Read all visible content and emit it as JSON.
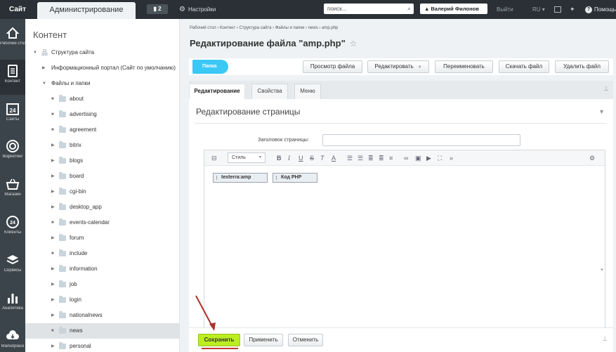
{
  "topbar": {
    "site_label": "Сайт",
    "admin_label": "Администрирование",
    "notifications_count": "2",
    "settings_label": "Настройки",
    "search_placeholder": "поиск...",
    "user_name": "Валерий Филонов",
    "logout_label": "Выйти",
    "language": "RU",
    "help_label": "Помощь"
  },
  "leftnav": {
    "items": [
      {
        "label": "Рабочий стол",
        "icon": "home-icon"
      },
      {
        "label": "Контент",
        "icon": "document-icon"
      },
      {
        "label": "Сайты",
        "icon": "calendar-24-icon"
      },
      {
        "label": "Маркетинг",
        "icon": "target-icon"
      },
      {
        "label": "Магазин",
        "icon": "basket-icon"
      },
      {
        "label": "Клиенты",
        "icon": "clients-24-icon"
      },
      {
        "label": "Сервисы",
        "icon": "layers-icon"
      },
      {
        "label": "Аналитика",
        "icon": "bar-chart-icon"
      },
      {
        "label": "Marketplace",
        "icon": "cloud-download-icon"
      }
    ]
  },
  "tree": {
    "title": "Контент",
    "root": "Структура сайта",
    "portal": "Информационный портал (Сайт по умолчанию)",
    "files": "Файлы и папки",
    "folders": [
      "about",
      "advertising",
      "agreement",
      "bitrix",
      "blogs",
      "board",
      "cgi-bin",
      "desktop_app",
      "events-calendar",
      "forum",
      "include",
      "information",
      "job",
      "login",
      "nationalnews",
      "news",
      "personal"
    ]
  },
  "breadcrumb": {
    "items": [
      "Рабочий стол",
      "Контент",
      "Структура сайта",
      "Файлы и папки",
      "news",
      "amp.php"
    ]
  },
  "page_title": "Редактирование файла \"amp.php\"",
  "toolbar": {
    "folder": "Папка",
    "view": "Просмотр файла",
    "edit": "Редактировать",
    "rename": "Переименовать",
    "download": "Скачать файл",
    "delete": "Удалить файл"
  },
  "tabs": [
    "Редактирование",
    "Свойства",
    "Меню"
  ],
  "section_title": "Редактирование страницы",
  "page_header_label": "Заголовок страницы:",
  "page_header_value": "",
  "editor": {
    "style_select": "Стиль",
    "chips": [
      "texterra:amp",
      "Код PHP"
    ]
  },
  "buttons": {
    "save": "Сохранить",
    "apply": "Применить",
    "cancel": "Отменить"
  },
  "colors": {
    "topbar": "#2a3036",
    "accent_blue": "#3bc8f5",
    "save_green": "#bbed21",
    "annotation_red": "#c0392b"
  }
}
